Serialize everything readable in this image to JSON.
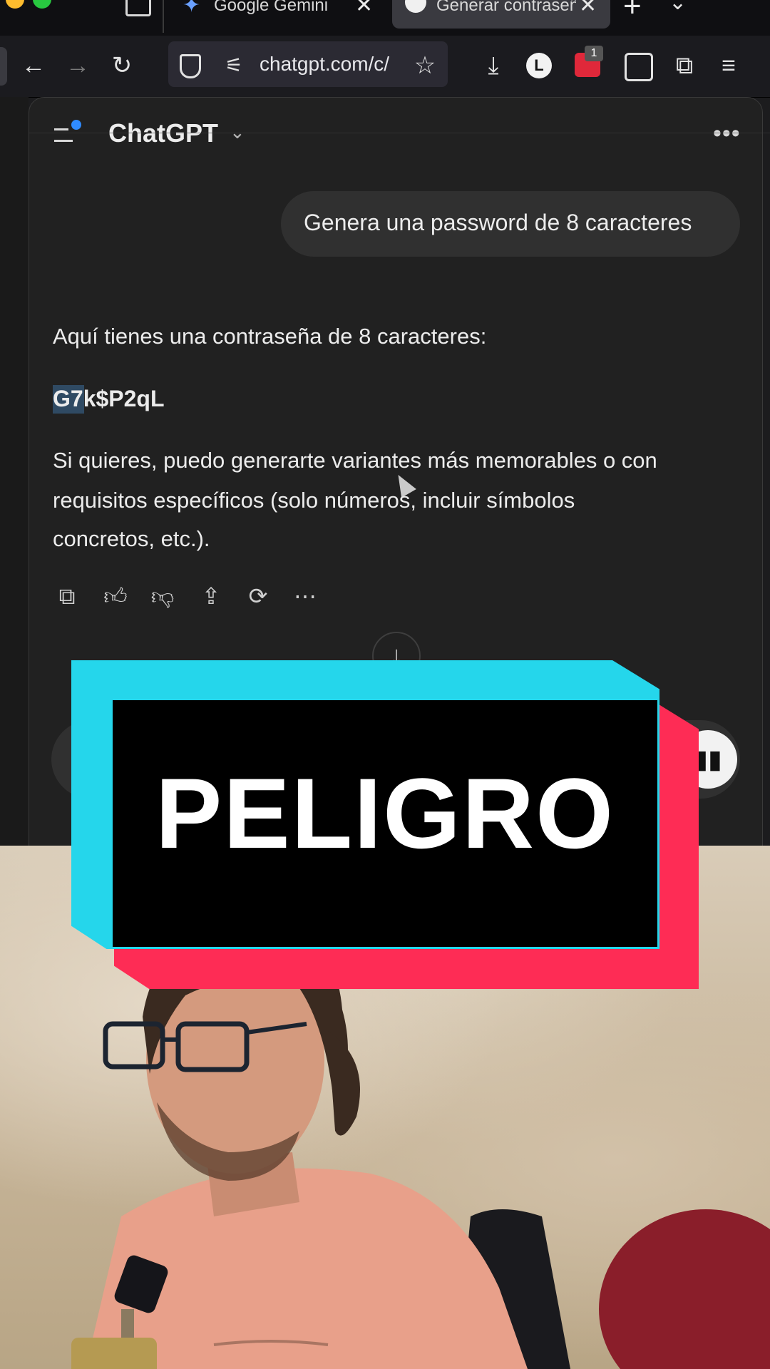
{
  "browser": {
    "tabs": [
      {
        "label": "Google Gemini",
        "active": false
      },
      {
        "label": "Generar contraseña",
        "active": true
      }
    ],
    "url": "chatgpt.com/c/",
    "extension_badge": "1",
    "profile_initial": "L"
  },
  "chat": {
    "app_title": "ChatGPT",
    "user_message": "Genera una password de 8 caracteres",
    "assistant": {
      "intro": "Aquí tienes una contraseña de 8 caracteres:",
      "password": "G7k$P2qL",
      "password_selected_part": "G7",
      "followup_lines": [
        "Si quieres, puedo generarte variantes más memorables o con",
        "requisitos específicos (solo números, incluir símbolos",
        "concretos, etc.)."
      ]
    },
    "actions": [
      "copy-icon",
      "thumbs-up-icon",
      "thumbs-down-icon",
      "share-icon",
      "regenerate-icon",
      "more-icon"
    ]
  },
  "overlay": {
    "caption": "PELIGRO",
    "colors": {
      "cyan": "#25d6eb",
      "pink": "#fe2c55",
      "box": "#000000",
      "text": "#ffffff"
    }
  },
  "colors": {
    "chat_bg": "#212121",
    "bubble_bg": "#303030",
    "selection": "#2f4a63"
  }
}
